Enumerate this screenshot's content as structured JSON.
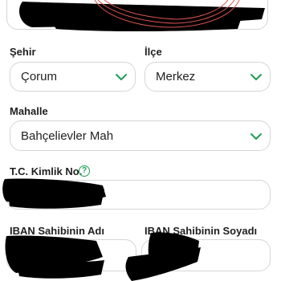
{
  "form": {
    "sehir_label": "Şehir",
    "sehir_value": "Çorum",
    "ilce_label": "İlçe",
    "ilce_value": "Merkez",
    "mahalle_label": "Mahalle",
    "mahalle_value": "Bahçelievler Mah",
    "tc_label": "T.C. Kimlik No.",
    "info_icon_glyph": "?",
    "iban_name_label": "IBAN Sahibinin Adı",
    "iban_surname_label": "IBAN Sahibinin Soyadı"
  },
  "colors": {
    "accent": "#1e9e52",
    "border": "#d6d6d6",
    "scribble": "#d9534f",
    "redaction": "#000000"
  },
  "icons": {
    "dropdown": "chevron-down-icon",
    "info": "question-circle-icon"
  }
}
